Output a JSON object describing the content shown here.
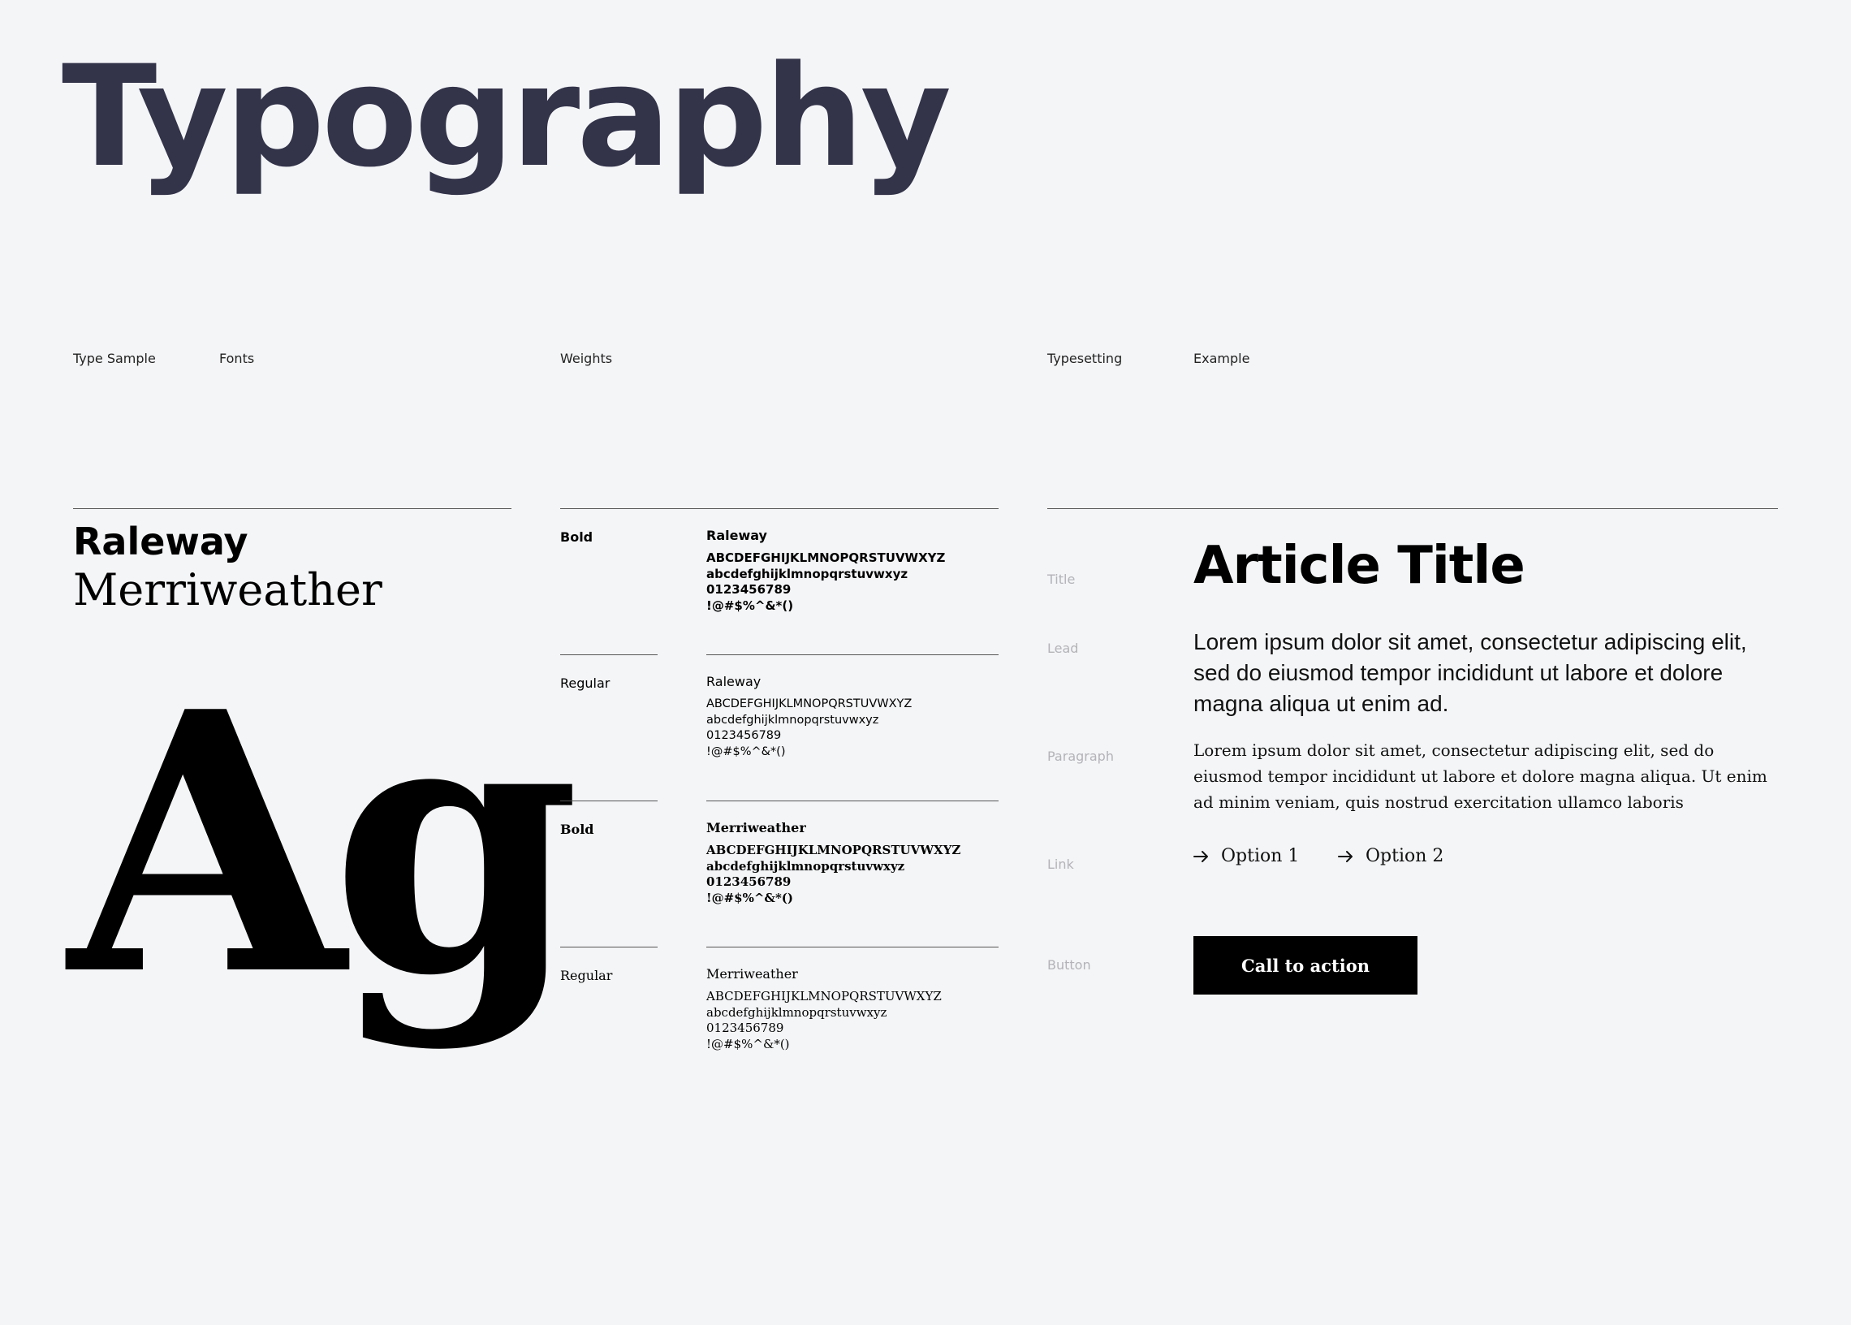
{
  "page": {
    "title": "Typography"
  },
  "columns": {
    "type_sample": "Type Sample",
    "fonts": "Fonts",
    "weights": "Weights",
    "typesetting": "Typesetting",
    "example": "Example"
  },
  "fonts": {
    "sans": "Raleway",
    "serif": "Merriweather",
    "glyph_sample": "Ag"
  },
  "weights": [
    {
      "label": "Bold",
      "font": "Raleway",
      "uppercase": "ABCDEFGHIJKLMNOPQRSTUVWXYZ",
      "lowercase": "abcdefghijklmnopqrstuvwxyz",
      "digits": "0123456789",
      "symbols": "!@#$%^&*()"
    },
    {
      "label": "Regular",
      "font": "Raleway",
      "uppercase": "ABCDEFGHIJKLMNOPQRSTUVWXYZ",
      "lowercase": "abcdefghijklmnopqrstuvwxyz",
      "digits": "0123456789",
      "symbols": "!@#$%^&*()"
    },
    {
      "label": "Bold",
      "font": "Merriweather",
      "uppercase": "ABCDEFGHIJKLMNOPQRSTUVWXYZ",
      "lowercase": "abcdefghijklmnopqrstuvwxyz",
      "digits": "0123456789",
      "symbols": "!@#$%^&*()"
    },
    {
      "label": "Regular",
      "font": "Merriweather",
      "uppercase": "ABCDEFGHIJKLMNOPQRSTUVWXYZ",
      "lowercase": "abcdefghijklmnopqrstuvwxyz",
      "digits": "0123456789",
      "symbols": "!@#$%^&*()"
    }
  ],
  "typesetting": {
    "labels": {
      "title": "Title",
      "lead": "Lead",
      "paragraph": "Paragraph",
      "link": "Link",
      "button": "Button"
    },
    "example": {
      "title": "Article Title",
      "lead": "Lorem ipsum dolor sit amet, consectetur adipiscing elit, sed do eiusmod tempor incididunt ut labore et dolore magna aliqua ut enim ad.",
      "paragraph": "Lorem ipsum dolor sit amet, consectetur adipiscing elit, sed do eiusmod tempor incididunt ut labore et dolore magna aliqua. Ut enim ad minim veniam, quis nostrud exercitation ullamco laboris",
      "links": [
        {
          "label": "Option 1",
          "icon": "arrow-right-icon"
        },
        {
          "label": "Option 2",
          "icon": "arrow-right-icon"
        }
      ],
      "button": "Call to action"
    }
  },
  "colors": {
    "background": "#f4f5f7",
    "page_title": "#33334a",
    "muted_label": "#b3b3b8",
    "button_bg": "#000000",
    "button_text": "#ffffff"
  }
}
